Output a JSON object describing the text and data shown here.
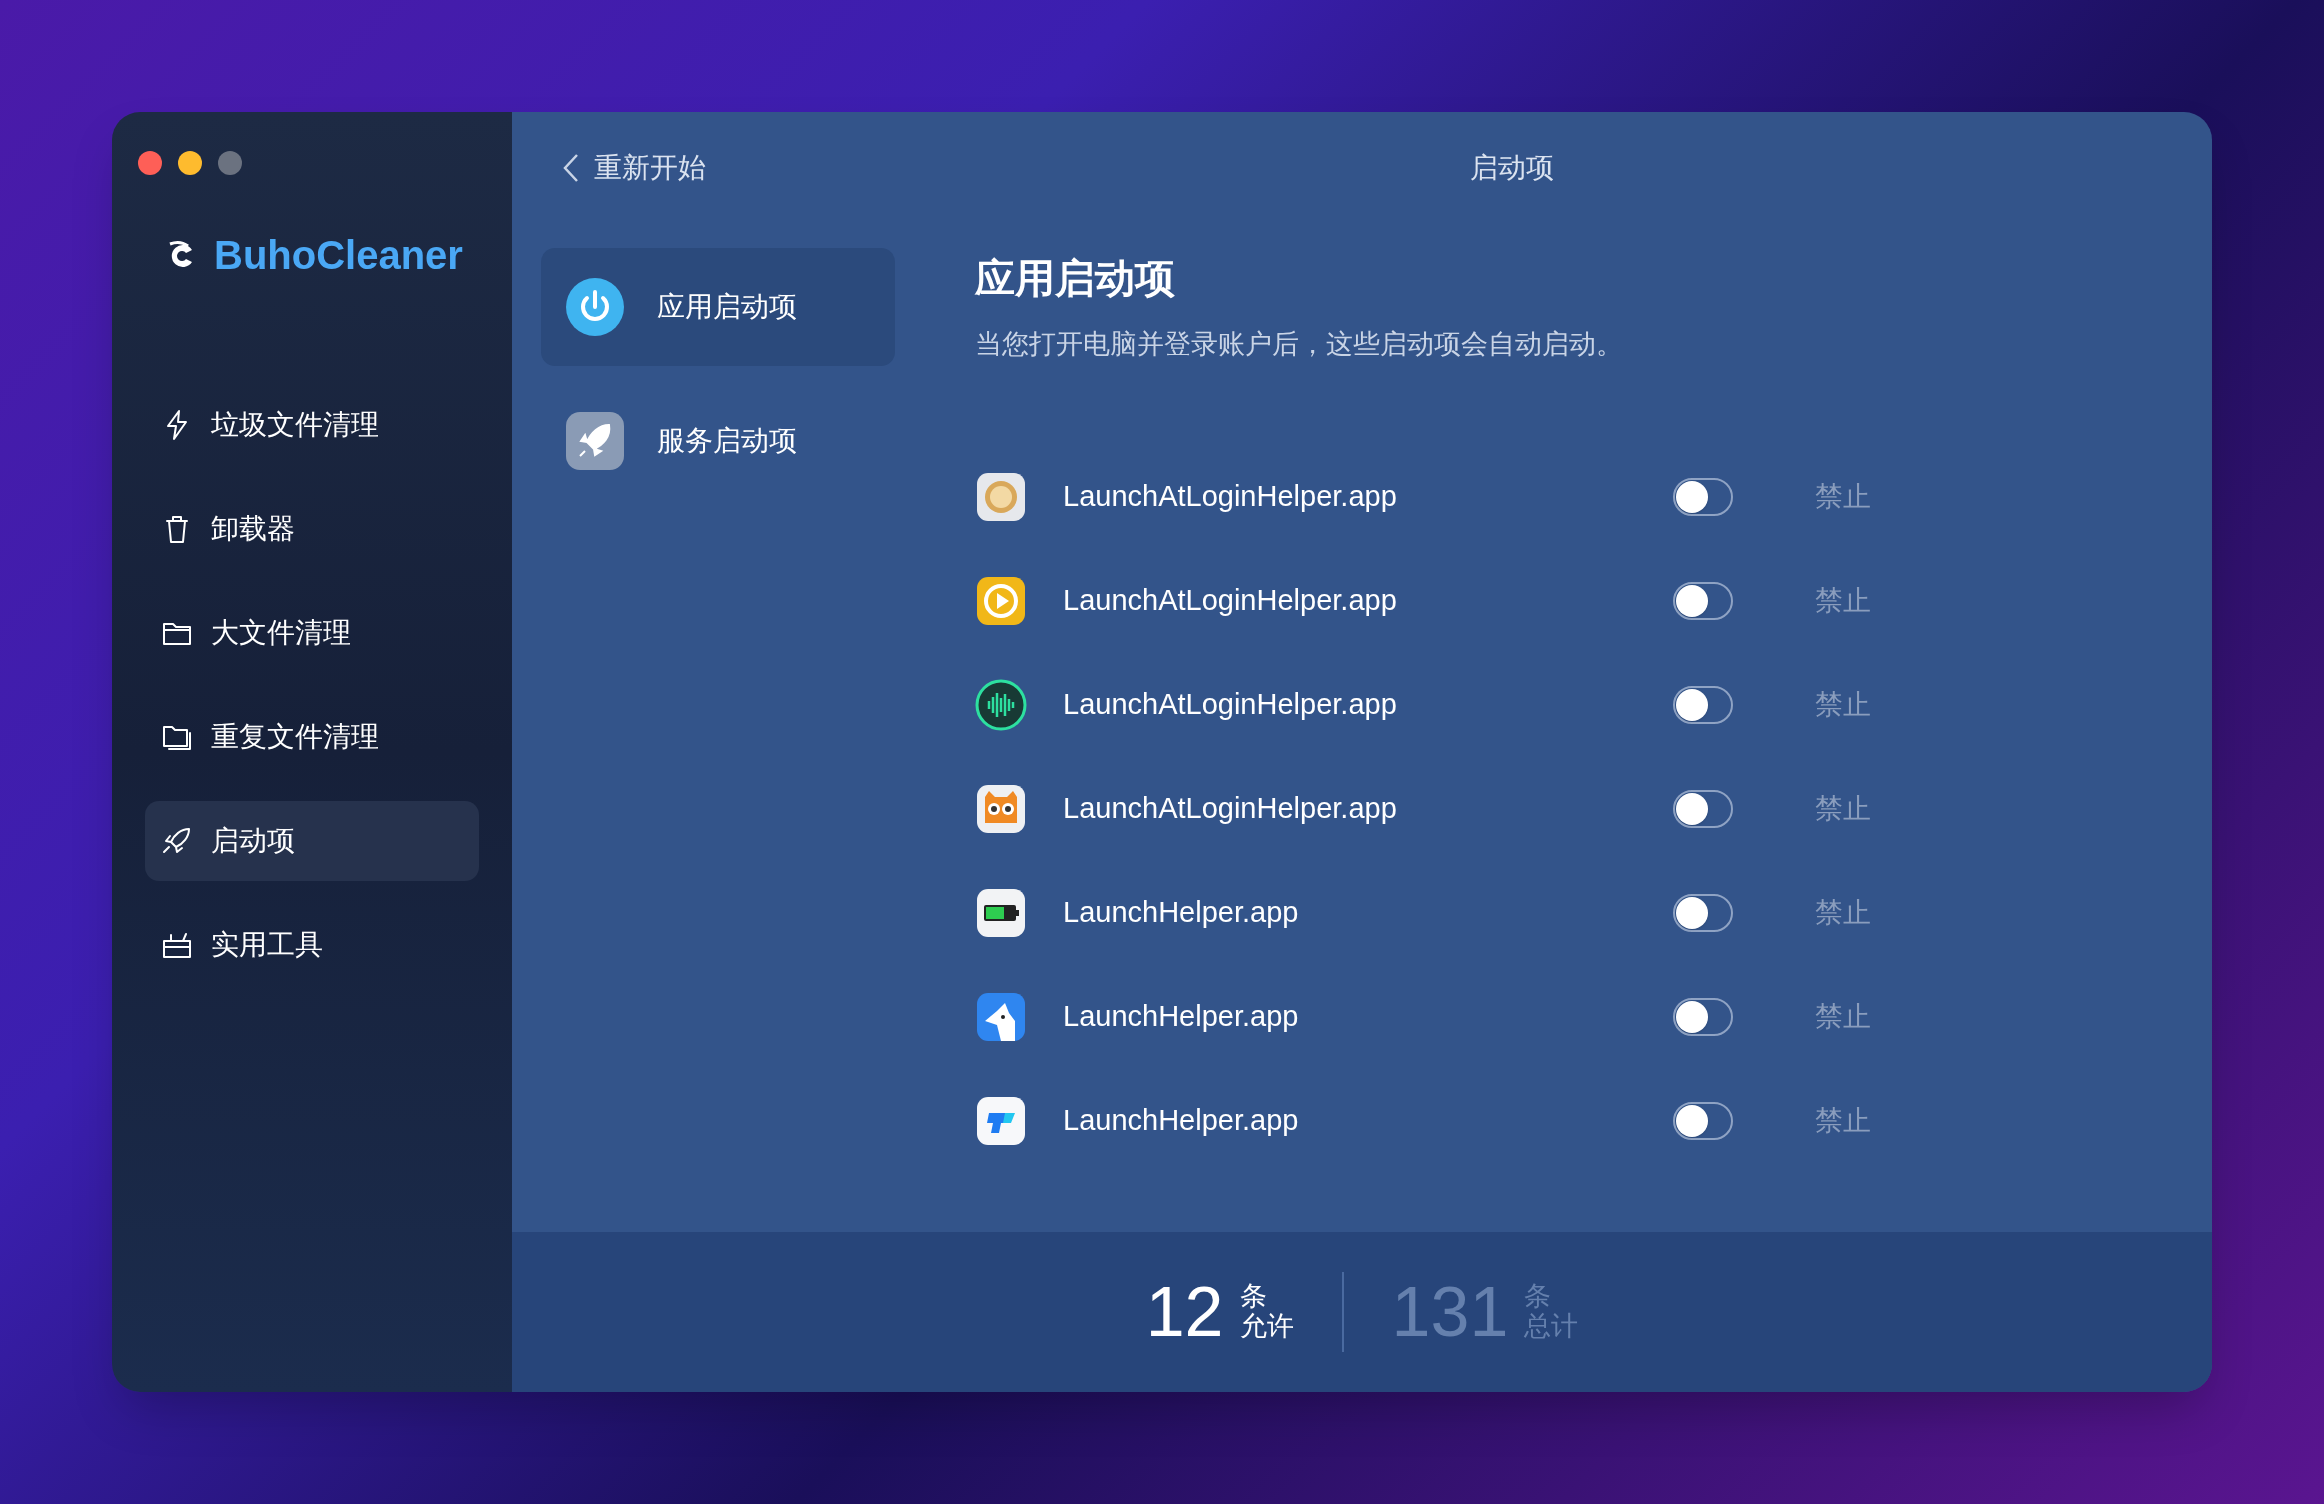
{
  "window": {
    "title": "启动项"
  },
  "sidebar": {
    "logo": "BuhoCleaner",
    "items": [
      {
        "label": "垃圾文件清理",
        "selected": false
      },
      {
        "label": "卸载器",
        "selected": false
      },
      {
        "label": "大文件清理",
        "selected": false
      },
      {
        "label": "重复文件清理",
        "selected": false
      },
      {
        "label": "启动项",
        "selected": true
      },
      {
        "label": "实用工具",
        "selected": false
      }
    ]
  },
  "back_button": "重新开始",
  "categories": [
    {
      "label": "应用启动项",
      "selected": true
    },
    {
      "label": "服务启动项",
      "selected": false
    }
  ],
  "content": {
    "heading": "应用启动项",
    "description": "当您打开电脑并登录账户后，这些启动项会自动启动。"
  },
  "items": [
    {
      "name": "LaunchAtLoginHelper.app",
      "on": false,
      "status": "禁止"
    },
    {
      "name": "LaunchAtLoginHelper.app",
      "on": false,
      "status": "禁止"
    },
    {
      "name": "LaunchAtLoginHelper.app",
      "on": false,
      "status": "禁止"
    },
    {
      "name": "LaunchAtLoginHelper.app",
      "on": false,
      "status": "禁止"
    },
    {
      "name": "LaunchHelper.app",
      "on": false,
      "status": "禁止"
    },
    {
      "name": "LaunchHelper.app",
      "on": false,
      "status": "禁止"
    },
    {
      "name": "LaunchHelper.app",
      "on": false,
      "status": "禁止"
    }
  ],
  "summary": {
    "allowed_count": "12",
    "allowed_unit": "条",
    "allowed_label": "允许",
    "total_count": "131",
    "total_unit": "条",
    "total_label": "总计"
  }
}
